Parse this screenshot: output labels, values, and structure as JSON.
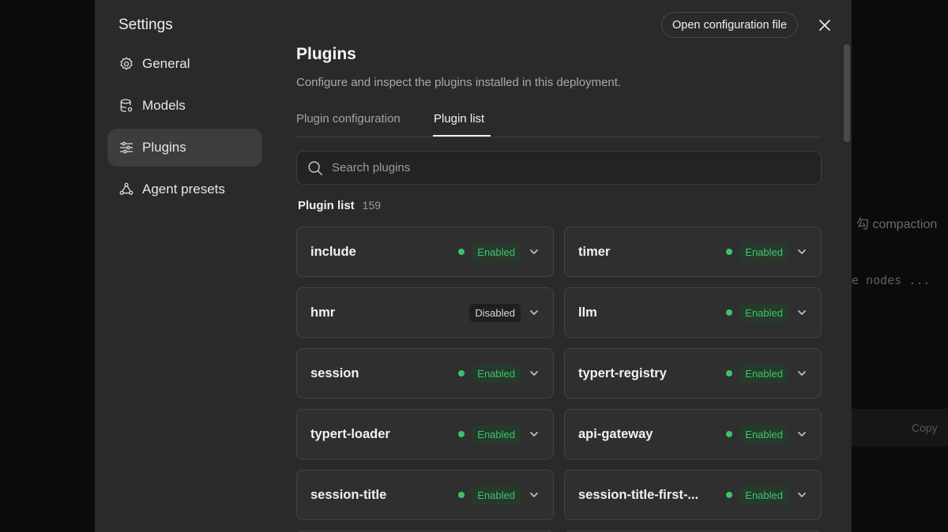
{
  "background": {
    "fragment_1": "勾 compaction",
    "fragment_2": "e nodes ...",
    "fragment_3": "Copy"
  },
  "settings": {
    "title": "Settings",
    "open_config_label": "Open configuration file"
  },
  "nav": {
    "items": [
      {
        "label": "General",
        "icon": "gear-icon"
      },
      {
        "label": "Models",
        "icon": "database-icon"
      },
      {
        "label": "Plugins",
        "icon": "sliders-icon"
      },
      {
        "label": "Agent presets",
        "icon": "agent-icon"
      }
    ],
    "active": "Plugins"
  },
  "page": {
    "title": "Plugins",
    "description": "Configure and inspect the plugins installed in this deployment."
  },
  "tabs": {
    "config": "Plugin configuration",
    "list": "Plugin list",
    "active": "Plugin list"
  },
  "search": {
    "placeholder": "Search plugins"
  },
  "list": {
    "label": "Plugin list",
    "count": "159"
  },
  "plugins": [
    {
      "name": "include",
      "status": "Enabled"
    },
    {
      "name": "timer",
      "status": "Enabled"
    },
    {
      "name": "hmr",
      "status": "Disabled"
    },
    {
      "name": "llm",
      "status": "Enabled"
    },
    {
      "name": "session",
      "status": "Enabled"
    },
    {
      "name": "typert-registry",
      "status": "Enabled"
    },
    {
      "name": "typert-loader",
      "status": "Enabled"
    },
    {
      "name": "api-gateway",
      "status": "Enabled"
    },
    {
      "name": "session-title",
      "status": "Enabled"
    },
    {
      "name": "session-title-first-...",
      "status": "Enabled"
    }
  ],
  "colors": {
    "enabled": "#3fc46c",
    "modal_bg": "#2a2a2a",
    "backdrop": "#0b0b0b"
  }
}
